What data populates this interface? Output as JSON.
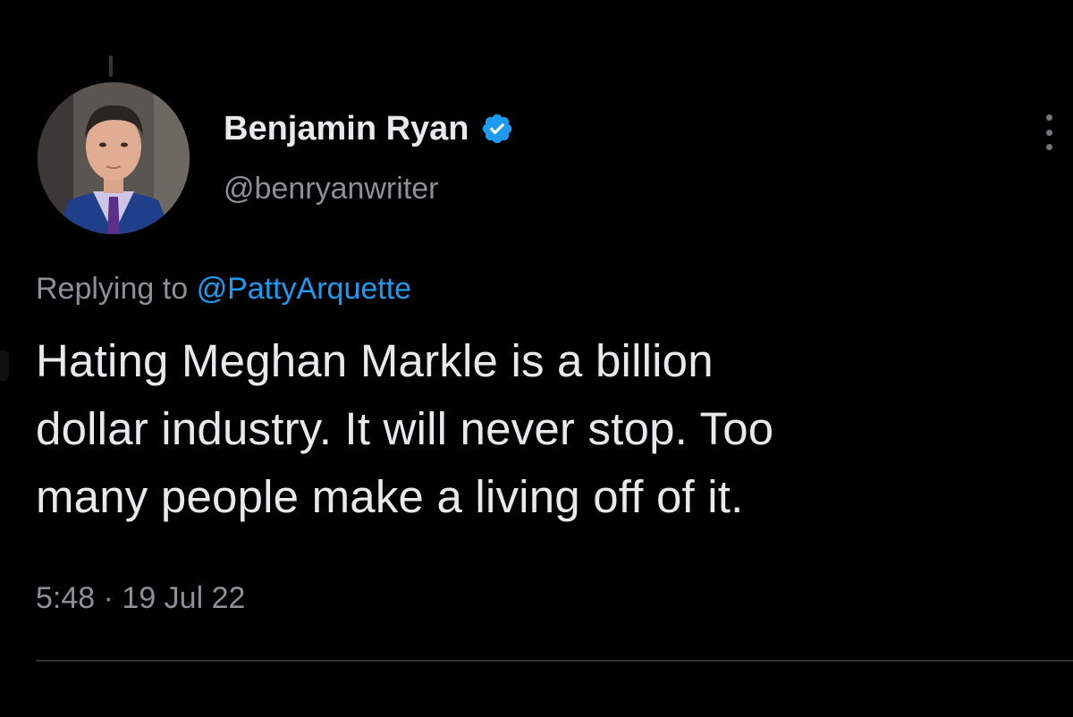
{
  "tweet": {
    "author": {
      "display_name": "Benjamin Ryan",
      "handle": "@benryanwriter",
      "verified": true,
      "avatar_icon": "profile-photo"
    },
    "reply_context": {
      "prefix": "Replying to",
      "mention": "@PattyArquette"
    },
    "text_lines": [
      "Hating Meghan Markle is a billion",
      "dollar industry. It will never stop. Too",
      "many people make a living off of it."
    ],
    "time": "5:48",
    "separator": "·",
    "date": "19 Jul 22",
    "menu_icon": "more-vertical-icon"
  },
  "colors": {
    "background": "#000000",
    "primary_text": "#e7e9ea",
    "secondary_text": "#8b9196",
    "link": "#1d9bf0",
    "verified_badge": "#1d9bf0"
  }
}
